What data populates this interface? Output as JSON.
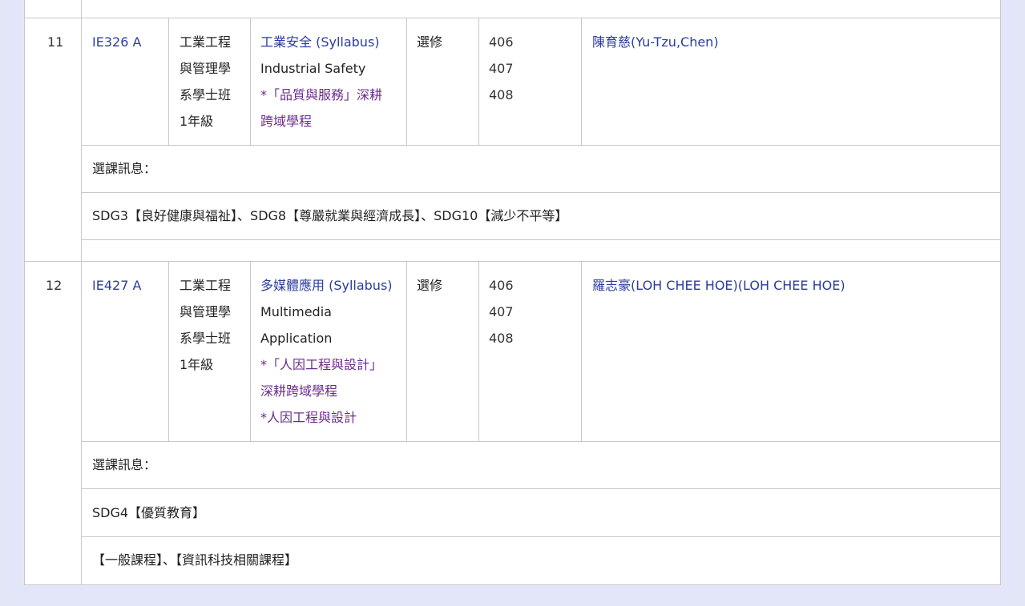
{
  "colors": {
    "link": "#2b3c9e",
    "program": "#6a2c8c",
    "border": "#c8c8c8",
    "background": "#e3e6f7"
  },
  "rows": [
    {
      "index": "11",
      "code": "IE326 A",
      "class_lines": [
        "工業工程",
        "與管理學",
        "系學士班",
        "1年級"
      ],
      "course_title": "工業安全 (Syllabus)",
      "english_lines": [
        "Industrial Safety"
      ],
      "program_lines": [
        "*「品質與服務」深耕",
        "跨域學程"
      ],
      "type": "選修",
      "rooms": [
        "406",
        "407",
        "408"
      ],
      "teacher": "陳育慈(Yu-Tzu,Chen)",
      "info_label": "選課訊息：",
      "sdg": "SDG3【良好健康與福祉】、SDG8【尊嚴就業與經濟成長】、SDG10【減少不平等】"
    },
    {
      "index": "12",
      "code": "IE427 A",
      "class_lines": [
        "工業工程",
        "與管理學",
        "系學士班",
        "1年級"
      ],
      "course_title": "多媒體應用 (Syllabus)",
      "english_lines": [
        "Multimedia",
        "Application"
      ],
      "program_lines": [
        "*「人因工程與設計」",
        "深耕跨域學程",
        "*人因工程與設計"
      ],
      "type": "選修",
      "rooms": [
        "406",
        "407",
        "408"
      ],
      "teacher": "羅志豪(LOH CHEE HOE)(LOH CHEE HOE)",
      "info_label": "選課訊息：",
      "sdg": "SDG4【優質教育】",
      "category": "【一般課程】、【資訊科技相關課程】"
    }
  ]
}
